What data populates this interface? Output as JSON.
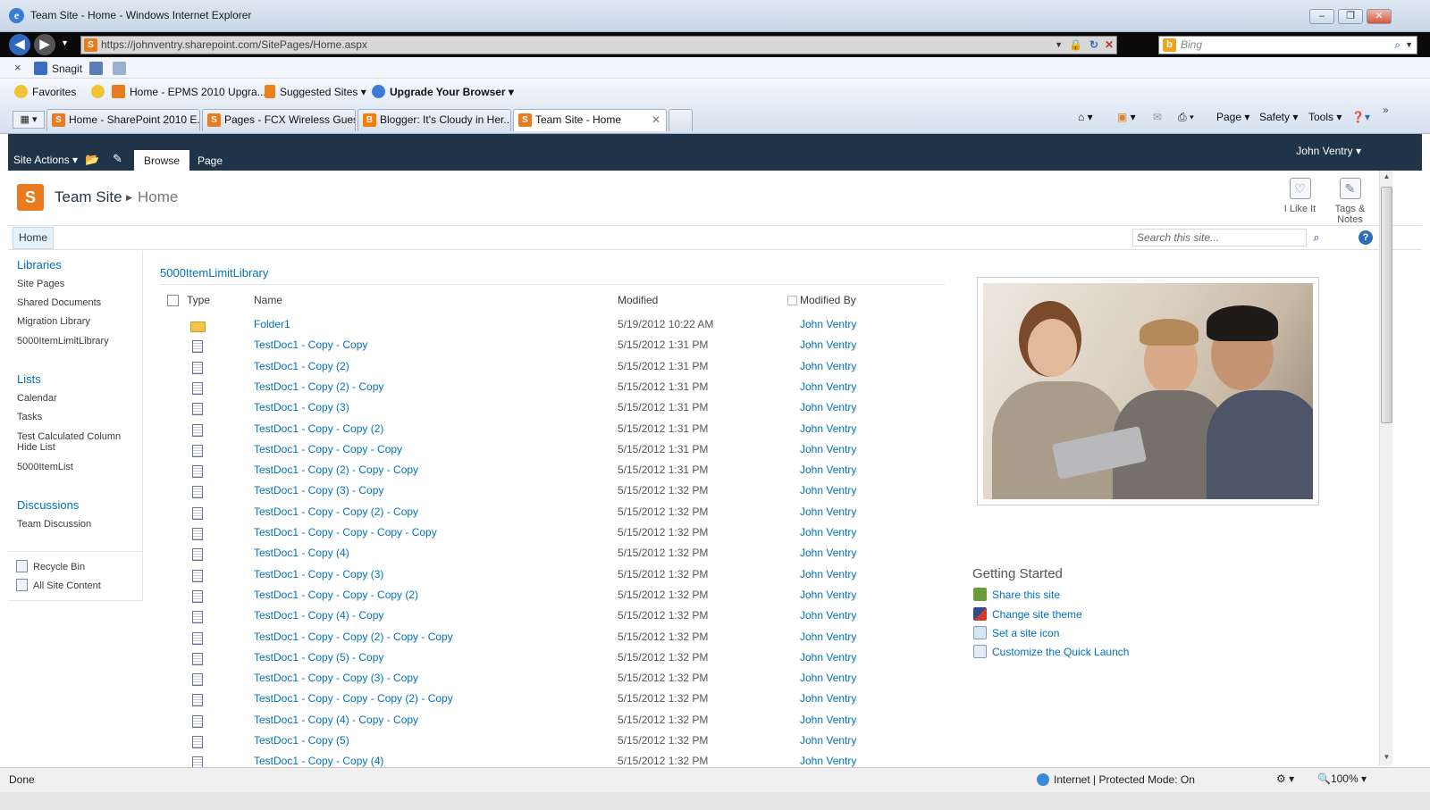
{
  "window": {
    "title": "Team Site - Home - Windows Internet Explorer"
  },
  "address": {
    "url": "https://johnventry.sharepoint.com/SitePages/Home.aspx",
    "search_placeholder": "Bing"
  },
  "command_bar": {
    "snagit": "Snagit"
  },
  "favorites_bar": {
    "favorites": "Favorites",
    "items": [
      "Home - EPMS 2010 Upgra...",
      "Suggested Sites",
      "Upgrade Your Browser"
    ]
  },
  "tabs": [
    {
      "label": "Home - SharePoint 2010 E...",
      "active": false
    },
    {
      "label": "Pages - FCX Wireless Gues...",
      "active": false
    },
    {
      "label": "Blogger: It's Cloudy in Her...",
      "active": false
    },
    {
      "label": "Team Site - Home",
      "active": true
    }
  ],
  "toolbar": {
    "page": "Page",
    "safety": "Safety",
    "tools": "Tools"
  },
  "ribbon": {
    "site_actions": "Site Actions",
    "tabs": [
      "Browse",
      "Page"
    ],
    "user": "John Ventry"
  },
  "header": {
    "site_title": "Team Site",
    "page_title": "Home",
    "i_like_it": "I Like It",
    "tags_notes": "Tags & Notes"
  },
  "top_nav": {
    "home": "Home",
    "search_placeholder": "Search this site..."
  },
  "quick_launch": {
    "libraries_heading": "Libraries",
    "libraries": [
      "Site Pages",
      "Shared Documents",
      "Migration Library",
      "5000ItemLimitLibrary"
    ],
    "lists_heading": "Lists",
    "lists": [
      "Calendar",
      "Tasks",
      "Test Calculated Column Hide List",
      "5000ItemList"
    ],
    "discussions_heading": "Discussions",
    "discussions": [
      "Team Discussion"
    ],
    "recycle_bin": "Recycle Bin",
    "all_site_content": "All Site Content"
  },
  "library": {
    "title": "5000ItemLimitLibrary",
    "columns": {
      "type": "Type",
      "name": "Name",
      "modified": "Modified",
      "modified_by": "Modified By"
    },
    "rows": [
      {
        "type": "folder",
        "name": "Folder1",
        "modified": "5/19/2012 10:22 AM",
        "by": "John Ventry"
      },
      {
        "type": "doc",
        "name": "TestDoc1 - Copy - Copy",
        "modified": "5/15/2012 1:31 PM",
        "by": "John Ventry"
      },
      {
        "type": "doc",
        "name": "TestDoc1 - Copy (2)",
        "modified": "5/15/2012 1:31 PM",
        "by": "John Ventry"
      },
      {
        "type": "doc",
        "name": "TestDoc1 - Copy (2) - Copy",
        "modified": "5/15/2012 1:31 PM",
        "by": "John Ventry"
      },
      {
        "type": "doc",
        "name": "TestDoc1 - Copy (3)",
        "modified": "5/15/2012 1:31 PM",
        "by": "John Ventry"
      },
      {
        "type": "doc",
        "name": "TestDoc1 - Copy - Copy (2)",
        "modified": "5/15/2012 1:31 PM",
        "by": "John Ventry"
      },
      {
        "type": "doc",
        "name": "TestDoc1 - Copy - Copy - Copy",
        "modified": "5/15/2012 1:31 PM",
        "by": "John Ventry"
      },
      {
        "type": "doc",
        "name": "TestDoc1 - Copy (2) - Copy - Copy",
        "modified": "5/15/2012 1:31 PM",
        "by": "John Ventry"
      },
      {
        "type": "doc",
        "name": "TestDoc1 - Copy (3) - Copy",
        "modified": "5/15/2012 1:32 PM",
        "by": "John Ventry"
      },
      {
        "type": "doc",
        "name": "TestDoc1 - Copy - Copy (2) - Copy",
        "modified": "5/15/2012 1:32 PM",
        "by": "John Ventry"
      },
      {
        "type": "doc",
        "name": "TestDoc1 - Copy - Copy - Copy - Copy",
        "modified": "5/15/2012 1:32 PM",
        "by": "John Ventry"
      },
      {
        "type": "doc",
        "name": "TestDoc1 - Copy (4)",
        "modified": "5/15/2012 1:32 PM",
        "by": "John Ventry"
      },
      {
        "type": "doc",
        "name": "TestDoc1 - Copy - Copy (3)",
        "modified": "5/15/2012 1:32 PM",
        "by": "John Ventry"
      },
      {
        "type": "doc",
        "name": "TestDoc1 - Copy - Copy - Copy (2)",
        "modified": "5/15/2012 1:32 PM",
        "by": "John Ventry"
      },
      {
        "type": "doc",
        "name": "TestDoc1 - Copy (4) - Copy",
        "modified": "5/15/2012 1:32 PM",
        "by": "John Ventry"
      },
      {
        "type": "doc",
        "name": "TestDoc1 - Copy - Copy (2) - Copy - Copy",
        "modified": "5/15/2012 1:32 PM",
        "by": "John Ventry"
      },
      {
        "type": "doc",
        "name": "TestDoc1 - Copy (5) - Copy",
        "modified": "5/15/2012 1:32 PM",
        "by": "John Ventry"
      },
      {
        "type": "doc",
        "name": "TestDoc1 - Copy - Copy (3) - Copy",
        "modified": "5/15/2012 1:32 PM",
        "by": "John Ventry"
      },
      {
        "type": "doc",
        "name": "TestDoc1 - Copy - Copy - Copy (2) - Copy",
        "modified": "5/15/2012 1:32 PM",
        "by": "John Ventry"
      },
      {
        "type": "doc",
        "name": "TestDoc1 - Copy (4) - Copy - Copy",
        "modified": "5/15/2012 1:32 PM",
        "by": "John Ventry"
      },
      {
        "type": "doc",
        "name": "TestDoc1 - Copy (5)",
        "modified": "5/15/2012 1:32 PM",
        "by": "John Ventry"
      },
      {
        "type": "doc",
        "name": "TestDoc1 - Copy - Copy (4)",
        "modified": "5/15/2012 1:32 PM",
        "by": "John Ventry"
      }
    ]
  },
  "getting_started": {
    "title": "Getting Started",
    "links": [
      "Share this site",
      "Change site theme",
      "Set a site icon",
      "Customize the Quick Launch"
    ]
  },
  "status_bar": {
    "status": "Done",
    "zone": "Internet | Protected Mode: On",
    "zoom": "100%"
  },
  "colors": {
    "ribbon": "#1f3349",
    "link": "#0072bc",
    "sp_orange": "#e87c1e"
  }
}
